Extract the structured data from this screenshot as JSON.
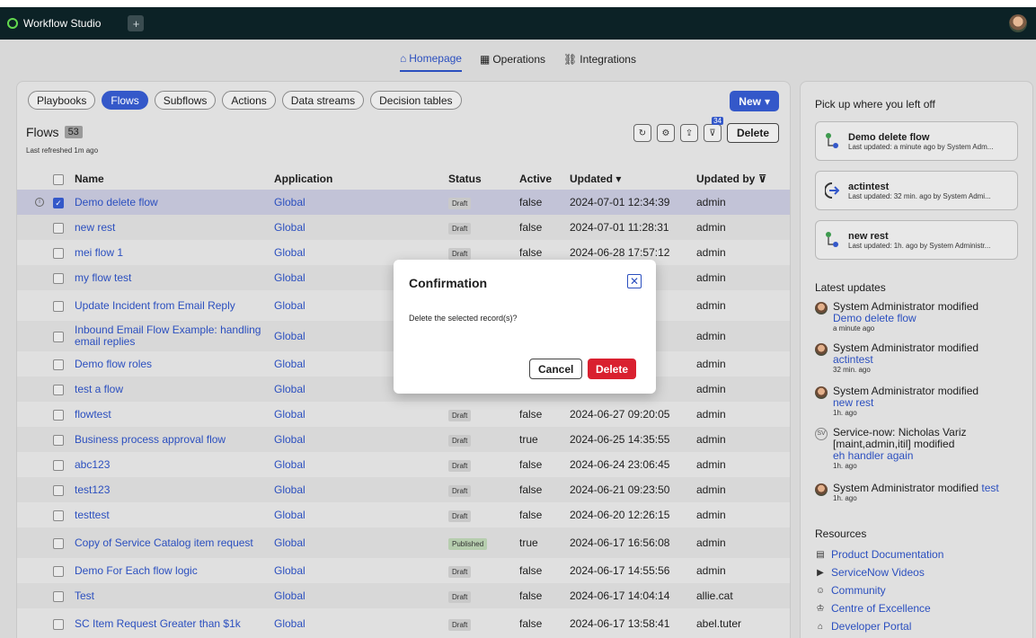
{
  "appbar": {
    "brand": "Workflow Studio",
    "new_tab": "+"
  },
  "nav": [
    {
      "label": "Homepage",
      "icon": "home-icon"
    },
    {
      "label": "Operations",
      "icon": "operations-icon"
    },
    {
      "label": "Integrations",
      "icon": "link-icon"
    }
  ],
  "chips": [
    "Playbooks",
    "Flows",
    "Subflows",
    "Actions",
    "Data streams",
    "Decision tables"
  ],
  "new_button": "New",
  "flows": {
    "title": "Flows",
    "count": "53",
    "refreshed": "Last refreshed 1m ago",
    "filter_count": "34",
    "delete_label": "Delete"
  },
  "columns": {
    "name": "Name",
    "application": "Application",
    "status": "Status",
    "active": "Active",
    "updated": "Updated",
    "updated_by": "Updated by"
  },
  "rows": [
    {
      "name": "Demo delete flow",
      "app": "Global",
      "status": "Draft",
      "active": "false",
      "updated": "2024-07-01 12:34:39",
      "by": "admin"
    },
    {
      "name": "new rest",
      "app": "Global",
      "status": "Draft",
      "active": "false",
      "updated": "2024-07-01 11:28:31",
      "by": "admin"
    },
    {
      "name": "mei flow 1",
      "app": "Global",
      "status": "Draft",
      "active": "false",
      "updated": "2024-06-28 17:57:12",
      "by": "admin"
    },
    {
      "name": "my flow test",
      "app": "Global",
      "status": "",
      "active": "",
      "updated": ":5:23",
      "by": "admin"
    },
    {
      "name": "Update Incident from Email Reply",
      "app": "Global",
      "status": "",
      "active": "",
      "updated": ":9:21",
      "by": "admin"
    },
    {
      "name": "Inbound Email Flow Example: handling email replies",
      "app": "Global",
      "status": "",
      "active": "",
      "updated": ":1:24",
      "by": "admin"
    },
    {
      "name": "Demo flow roles",
      "app": "Global",
      "status": "",
      "active": "",
      "updated": ":7:02",
      "by": "admin"
    },
    {
      "name": "test a flow",
      "app": "Global",
      "status": "",
      "active": "",
      "updated": ":1:30",
      "by": "admin"
    },
    {
      "name": "flowtest",
      "app": "Global",
      "status": "Draft",
      "active": "false",
      "updated": "2024-06-27 09:20:05",
      "by": "admin"
    },
    {
      "name": "Business process approval flow",
      "app": "Global",
      "status": "Draft",
      "active": "true",
      "updated": "2024-06-25 14:35:55",
      "by": "admin"
    },
    {
      "name": "abc123",
      "app": "Global",
      "status": "Draft",
      "active": "false",
      "updated": "2024-06-24 23:06:45",
      "by": "admin"
    },
    {
      "name": "test123",
      "app": "Global",
      "status": "Draft",
      "active": "false",
      "updated": "2024-06-21 09:23:50",
      "by": "admin"
    },
    {
      "name": "testtest",
      "app": "Global",
      "status": "Draft",
      "active": "false",
      "updated": "2024-06-20 12:26:15",
      "by": "admin"
    },
    {
      "name": "Copy of Service Catalog item request",
      "app": "Global",
      "status": "Published",
      "active": "true",
      "updated": "2024-06-17 16:56:08",
      "by": "admin"
    },
    {
      "name": "Demo For Each flow logic",
      "app": "Global",
      "status": "Draft",
      "active": "false",
      "updated": "2024-06-17 14:55:56",
      "by": "admin"
    },
    {
      "name": "Test",
      "app": "Global",
      "status": "Draft",
      "active": "false",
      "updated": "2024-06-17 14:04:14",
      "by": "allie.cat"
    },
    {
      "name": "SC Item Request Greater than $1k",
      "app": "Global",
      "status": "Draft",
      "active": "false",
      "updated": "2024-06-17 13:58:41",
      "by": "abel.tuter"
    }
  ],
  "side": {
    "pickup_title": "Pick up where you left off",
    "recent": [
      {
        "title": "Demo delete flow",
        "sub": "Last updated: a minute ago by System Adm...",
        "icon": "flow-icon"
      },
      {
        "title": "actintest",
        "sub": "Last updated: 32 min. ago by System Admi...",
        "icon": "action-icon"
      },
      {
        "title": "new rest",
        "sub": "Last updated: 1h. ago by System Administr...",
        "icon": "flow-icon"
      }
    ],
    "updates_title": "Latest updates",
    "updates": [
      {
        "who": "System Administrator modified",
        "item": "Demo delete flow",
        "time": "a minute ago"
      },
      {
        "who": "System Administrator modified",
        "item": "actintest",
        "time": "32 min. ago"
      },
      {
        "who": "System Administrator modified",
        "item": "new rest",
        "time": "1h. ago"
      },
      {
        "who": "Service-now: Nicholas Variz [maint,admin,itil] modified",
        "item": "eh handler again",
        "time": "1h. ago"
      },
      {
        "who": "System Administrator modified",
        "item": "test",
        "time": "1h. ago"
      }
    ],
    "resources_title": "Resources",
    "resources": [
      {
        "label": "Product Documentation",
        "icon": "doc-icon"
      },
      {
        "label": "ServiceNow Videos",
        "icon": "play-icon"
      },
      {
        "label": "Community",
        "icon": "community-icon"
      },
      {
        "label": "Centre of Excellence",
        "icon": "excellence-icon"
      },
      {
        "label": "Developer Portal",
        "icon": "developer-icon"
      }
    ]
  },
  "modal": {
    "title": "Confirmation",
    "message": "Delete the selected record(s)?",
    "cancel": "Cancel",
    "delete": "Delete"
  }
}
